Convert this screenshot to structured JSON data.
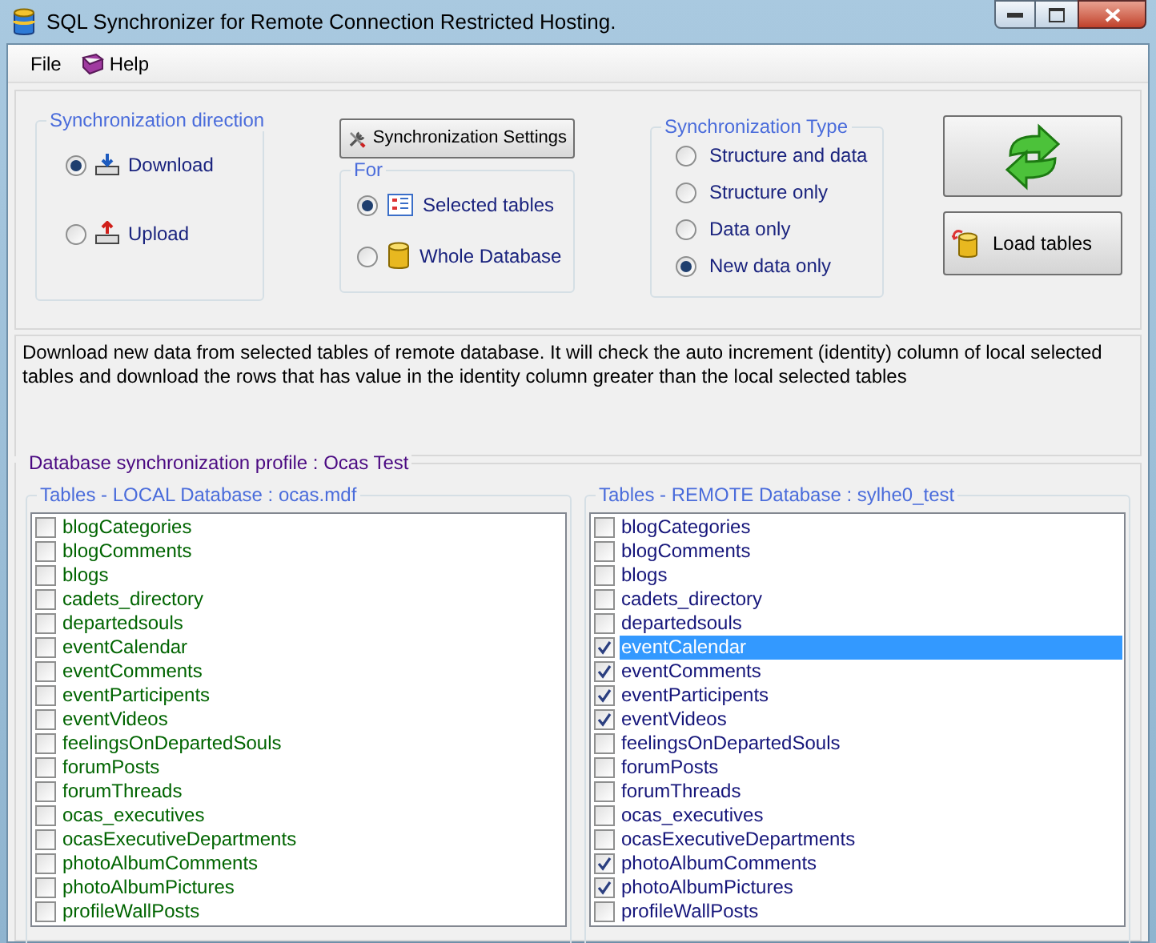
{
  "window": {
    "title": "SQL Synchronizer for Remote Connection Restricted Hosting."
  },
  "menu": [
    {
      "label": "File",
      "kind": "text"
    },
    {
      "label": "Help",
      "kind": "book"
    }
  ],
  "direction": {
    "title": "Synchronization direction",
    "options": [
      {
        "label": "Download",
        "kind": "download",
        "selected": true
      },
      {
        "label": "Upload",
        "kind": "upload",
        "selected": false
      }
    ]
  },
  "settings_button": {
    "label": "Synchronization Settings"
  },
  "for_group": {
    "title": "For",
    "options": [
      {
        "label": "Selected tables",
        "kind": "tables",
        "selected": true
      },
      {
        "label": "Whole Database",
        "kind": "database",
        "selected": false
      }
    ]
  },
  "sync_type": {
    "title": "Synchronization Type",
    "options": [
      {
        "label": "Structure and data",
        "selected": false
      },
      {
        "label": "Structure only",
        "selected": false
      },
      {
        "label": "Data only",
        "selected": false
      },
      {
        "label": "New data only",
        "selected": true
      }
    ]
  },
  "load_button": {
    "label": "Load tables"
  },
  "description": "Download new data from selected tables of remote database. It will check the auto increment (identity) column of local selected tables and download the rows that has value in the identity column greater than the local selected tables",
  "profile": {
    "title": "Database synchronization profile : Ocas Test"
  },
  "local": {
    "title": "Tables - LOCAL Database :  ocas.mdf",
    "tables": [
      {
        "name": "blogCategories",
        "checked": false,
        "selected": false
      },
      {
        "name": "blogComments",
        "checked": false,
        "selected": false
      },
      {
        "name": "blogs",
        "checked": false,
        "selected": false
      },
      {
        "name": "cadets_directory",
        "checked": false,
        "selected": false
      },
      {
        "name": "departedsouls",
        "checked": false,
        "selected": false
      },
      {
        "name": "eventCalendar",
        "checked": false,
        "selected": false
      },
      {
        "name": "eventComments",
        "checked": false,
        "selected": false
      },
      {
        "name": "eventParticipents",
        "checked": false,
        "selected": false
      },
      {
        "name": "eventVideos",
        "checked": false,
        "selected": false
      },
      {
        "name": "feelingsOnDepartedSouls",
        "checked": false,
        "selected": false
      },
      {
        "name": "forumPosts",
        "checked": false,
        "selected": false
      },
      {
        "name": "forumThreads",
        "checked": false,
        "selected": false
      },
      {
        "name": "ocas_executives",
        "checked": false,
        "selected": false
      },
      {
        "name": "ocasExecutiveDepartments",
        "checked": false,
        "selected": false
      },
      {
        "name": "photoAlbumComments",
        "checked": false,
        "selected": false
      },
      {
        "name": "photoAlbumPictures",
        "checked": false,
        "selected": false
      },
      {
        "name": "profileWallPosts",
        "checked": false,
        "selected": false
      }
    ]
  },
  "remote": {
    "title": "Tables - REMOTE Database :  sylhe0_test",
    "tables": [
      {
        "name": "blogCategories",
        "checked": false,
        "selected": false
      },
      {
        "name": "blogComments",
        "checked": false,
        "selected": false
      },
      {
        "name": "blogs",
        "checked": false,
        "selected": false
      },
      {
        "name": "cadets_directory",
        "checked": false,
        "selected": false
      },
      {
        "name": "departedsouls",
        "checked": false,
        "selected": false
      },
      {
        "name": "eventCalendar",
        "checked": true,
        "selected": true
      },
      {
        "name": "eventComments",
        "checked": true,
        "selected": false
      },
      {
        "name": "eventParticipents",
        "checked": true,
        "selected": false
      },
      {
        "name": "eventVideos",
        "checked": true,
        "selected": false
      },
      {
        "name": "feelingsOnDepartedSouls",
        "checked": false,
        "selected": false
      },
      {
        "name": "forumPosts",
        "checked": false,
        "selected": false
      },
      {
        "name": "forumThreads",
        "checked": false,
        "selected": false
      },
      {
        "name": "ocas_executives",
        "checked": false,
        "selected": false
      },
      {
        "name": "ocasExecutiveDepartments",
        "checked": false,
        "selected": false
      },
      {
        "name": "photoAlbumComments",
        "checked": true,
        "selected": false
      },
      {
        "name": "photoAlbumPictures",
        "checked": true,
        "selected": false
      },
      {
        "name": "profileWallPosts",
        "checked": false,
        "selected": false
      }
    ]
  }
}
